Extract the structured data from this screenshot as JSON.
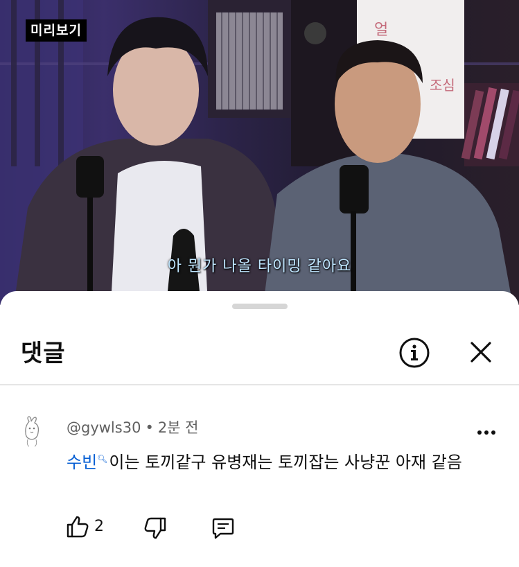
{
  "video": {
    "badge": "미리보기",
    "subtitle": "아 뭔가 나올 타이밍 같아요"
  },
  "sheet": {
    "title": "댓글",
    "info_icon": "info-circle-icon",
    "close_icon": "close-icon"
  },
  "comment": {
    "author": "@gywls30",
    "separator": "•",
    "time": "2분 전",
    "mention": "수빈",
    "mention_icon": "search-icon",
    "text": "이는 토끼같구 유병재는 토끼잡는 사냥꾼 아재 같음",
    "likes": "2",
    "more_icon": "more-vert-icon",
    "like_icon": "thumb-up-icon",
    "dislike_icon": "thumb-down-icon",
    "reply_icon": "comment-reply-icon"
  },
  "colors": {
    "mention": "#065fd4",
    "meta": "#606060",
    "text": "#0f0f0f",
    "subtitle": "#bfe6ff"
  }
}
